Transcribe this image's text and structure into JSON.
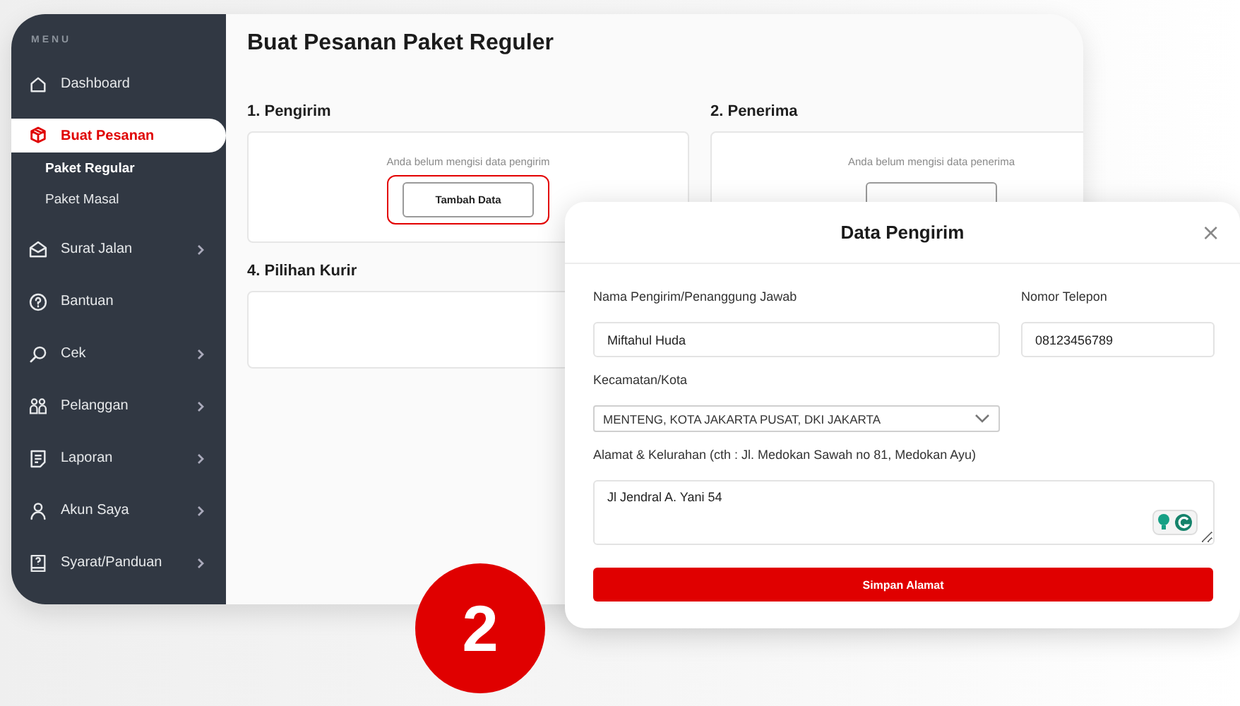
{
  "sidebar": {
    "heading": "MENU",
    "items": [
      {
        "label": "Dashboard",
        "selected": false,
        "expandable": false
      },
      {
        "label": "Buat Pesanan",
        "selected": true,
        "expandable": false,
        "children": [
          {
            "label": "Paket Regular",
            "selected": true
          },
          {
            "label": "Paket Masal",
            "selected": false
          }
        ]
      },
      {
        "label": "Surat Jalan",
        "selected": false,
        "expandable": true
      },
      {
        "label": "Bantuan",
        "selected": false,
        "expandable": false
      },
      {
        "label": "Cek",
        "selected": false,
        "expandable": true
      },
      {
        "label": "Pelanggan",
        "selected": false,
        "expandable": true
      },
      {
        "label": "Laporan",
        "selected": false,
        "expandable": true
      },
      {
        "label": "Akun Saya",
        "selected": false,
        "expandable": true
      },
      {
        "label": "Syarat/Panduan",
        "selected": false,
        "expandable": true
      }
    ]
  },
  "page": {
    "title": "Buat Pesanan Paket Reguler",
    "sections": [
      {
        "heading": "1. Pengirim",
        "message": "Anda belum mengisi data pengirim",
        "button": {
          "label": "Tambah Data",
          "highlighted": true
        }
      },
      {
        "heading": "2. Penerima",
        "message": "Anda belum mengisi data penerima",
        "button": {
          "highlighted": false
        }
      },
      {
        "heading": "4. Pilihan Kurir"
      }
    ]
  },
  "dialog": {
    "title": "Data Pengirim",
    "close": "×",
    "fields": [
      {
        "kind": "text",
        "label": "Nama Pengirim/Penanggung Jawab",
        "value": "Miftahul Huda"
      },
      {
        "kind": "text",
        "label": "Nomor Telepon",
        "value": "08123456789"
      },
      {
        "kind": "select",
        "label": "Kecamatan/Kota",
        "value": "MENTENG, KOTA JAKARTA PUSAT, DKI JAKARTA"
      },
      {
        "kind": "textarea",
        "label": "Alamat & Kelurahan (cth : Jl. Medokan Sawah no 81, Medokan Ayu)",
        "value": "Jl Jendral A. Yani 54"
      }
    ],
    "button": "Simpan Alamat"
  },
  "step_badge": "2"
}
